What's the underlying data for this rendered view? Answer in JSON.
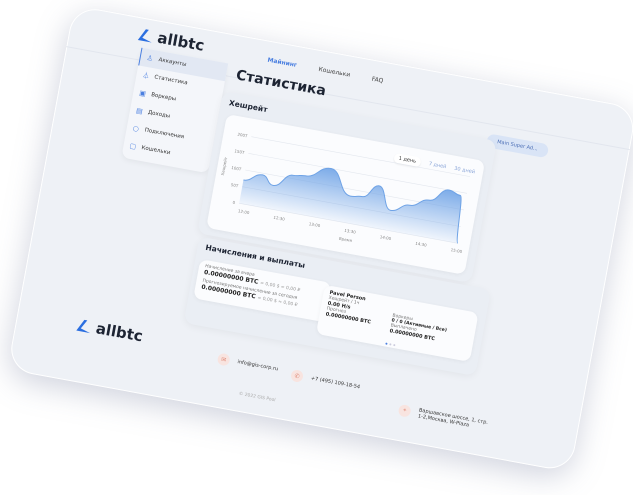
{
  "brand": "allbtc",
  "nav": [
    {
      "label": "Майнинг",
      "active": true
    },
    {
      "label": "Кошельки"
    },
    {
      "label": "FAQ"
    }
  ],
  "user_button": "Main Super Ad...",
  "sidebar": {
    "items": [
      {
        "label": "Аккаунты",
        "icon": "user-icon",
        "active": true
      },
      {
        "label": "Статистика",
        "icon": "chart-icon"
      },
      {
        "label": "Воркеры",
        "icon": "worker-icon"
      },
      {
        "label": "Доходы",
        "icon": "income-icon"
      },
      {
        "label": "Подключения",
        "icon": "connection-icon"
      },
      {
        "label": "Кошельки",
        "icon": "wallet-icon"
      }
    ]
  },
  "page_title": "Статистика",
  "hashrate": {
    "title": "Хешрейт",
    "ranges": [
      "1 день",
      "7 дней",
      "30 дней"
    ],
    "active_range": "1 день"
  },
  "chart_data": {
    "type": "area",
    "xlabel": "Время",
    "ylabel": "Хешрейт",
    "x_ticks": [
      "12:00",
      "12:30",
      "13:00",
      "13:30",
      "14:00",
      "14:30",
      "15:00"
    ],
    "y_ticks": [
      "0",
      "50T",
      "100T",
      "150T",
      "200T"
    ],
    "ylim": [
      0,
      200
    ],
    "x": [
      "11:55",
      "12:10",
      "12:20",
      "12:35",
      "12:45",
      "13:05",
      "13:25",
      "13:35",
      "13:47",
      "14:00",
      "14:15",
      "14:30",
      "14:45",
      "14:55",
      "15:00"
    ],
    "values": [
      70,
      95,
      70,
      110,
      115,
      150,
      80,
      85,
      125,
      60,
      85,
      110,
      150,
      140,
      0
    ],
    "color": "#6fa3e6",
    "grid": true
  },
  "earnings": {
    "title": "Начисления и выплаты",
    "yesterday_label": "Начисление за вчера",
    "yesterday_value": "0.00000000 BTC",
    "yesterday_sub": "≈ 0,00 $ ≈ 0,00 ₽",
    "today_label": "Прогнозируемое начисление за сегодня",
    "today_value": "0.00000000 BTC",
    "today_sub": "≈ 0,00 $ ≈ 0,00 ₽",
    "account": {
      "name": "Pavel Person",
      "hashrate_label": "Хешрейт / 1ч",
      "hashrate_value": "0.00 H/s",
      "forecast_label": "Прогноз",
      "forecast_value": "0.00000000 BTC",
      "workers_label": "Воркеры",
      "workers_value": "0 / 0 (Активные / Все)",
      "paid_label": "Выплачено",
      "paid_value": "0.00000000 BTC"
    }
  },
  "footer": {
    "email": "info@gis-corp.ru",
    "phone": "+7 (495) 109-18-54",
    "address_line1": "Варшавское шоссе, 1, стр.",
    "address_line2": "1-2,Москва, W-Plaza",
    "copyright": "© 2022 GIS Pool"
  }
}
